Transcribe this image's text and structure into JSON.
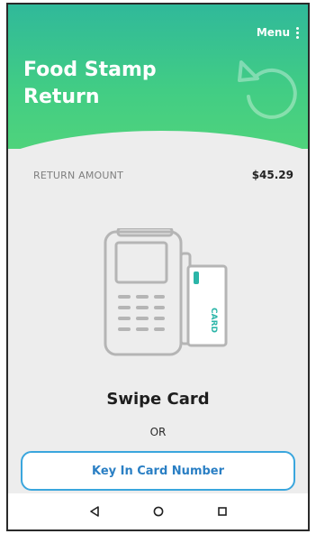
{
  "header": {
    "menu_label": "Menu",
    "title": "Food Stamp Return",
    "icon": "return-arrow-icon",
    "gradient_top": "#30b99a",
    "gradient_bottom": "#4fd37c"
  },
  "amount": {
    "label": "RETURN AMOUNT",
    "value": "$45.29"
  },
  "illustration": {
    "icon": "card-terminal-icon",
    "card_text": "CARD"
  },
  "prompt": {
    "title": "Swipe Card",
    "separator": "OR"
  },
  "key_in_button": {
    "label": "Key In Card Number",
    "border_color": "#3aa6dd",
    "text_color": "#2a7fc4"
  },
  "navbar": {
    "back_icon": "nav-back-icon",
    "home_icon": "nav-home-icon",
    "recents_icon": "nav-recents-icon"
  }
}
